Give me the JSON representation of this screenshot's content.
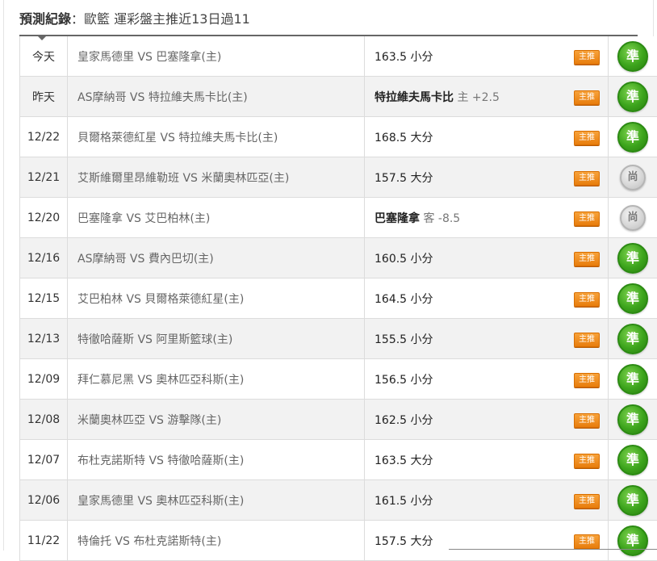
{
  "header": {
    "title": "預測紀錄",
    "separator": "：",
    "subtitle": "歐籃 運彩盤主推近13日過11"
  },
  "colors": {
    "badge": "#f08a1c",
    "result_hit": "#3ca41c",
    "result_miss": "#cfcfcf",
    "row_alt": "#f2f2f2"
  },
  "rows": [
    {
      "date": "今天",
      "match": "皇家馬德里 VS 巴塞隆拿(主)",
      "pick_main": "163.5 小分",
      "pick_extra": "",
      "badge": "主推",
      "result": "準",
      "hit": true
    },
    {
      "date": "昨天",
      "match": "AS摩納哥 VS 特拉維夫馬卡比(主)",
      "pick_main": "特拉維夫馬卡比",
      "pick_extra": " 主 +2.5",
      "badge": "主推",
      "result": "準",
      "hit": true
    },
    {
      "date": "12/22",
      "match": "貝爾格萊德紅星 VS 特拉維夫馬卡比(主)",
      "pick_main": "168.5 大分",
      "pick_extra": "",
      "badge": "主推",
      "result": "準",
      "hit": true
    },
    {
      "date": "12/21",
      "match": "艾斯維爾里昂維勒班 VS 米蘭奧林匹亞(主)",
      "pick_main": "157.5 大分",
      "pick_extra": "",
      "badge": "主推",
      "result": "尚",
      "hit": false
    },
    {
      "date": "12/20",
      "match": "巴塞隆拿 VS 艾巴柏林(主)",
      "pick_main": "巴塞隆拿",
      "pick_extra": " 客 -8.5",
      "badge": "主推",
      "result": "尚",
      "hit": false
    },
    {
      "date": "12/16",
      "match": "AS摩納哥 VS 費內巴切(主)",
      "pick_main": "160.5 小分",
      "pick_extra": "",
      "badge": "主推",
      "result": "準",
      "hit": true
    },
    {
      "date": "12/15",
      "match": "艾巴柏林 VS 貝爾格萊德紅星(主)",
      "pick_main": "164.5 小分",
      "pick_extra": "",
      "badge": "主推",
      "result": "準",
      "hit": true
    },
    {
      "date": "12/13",
      "match": "特徹哈薩斯 VS 阿里斯籃球(主)",
      "pick_main": "155.5 小分",
      "pick_extra": "",
      "badge": "主推",
      "result": "準",
      "hit": true
    },
    {
      "date": "12/09",
      "match": "拜仁慕尼黑 VS 奧林匹亞科斯(主)",
      "pick_main": "156.5 小分",
      "pick_extra": "",
      "badge": "主推",
      "result": "準",
      "hit": true
    },
    {
      "date": "12/08",
      "match": "米蘭奧林匹亞 VS 游擊隊(主)",
      "pick_main": "162.5 小分",
      "pick_extra": "",
      "badge": "主推",
      "result": "準",
      "hit": true
    },
    {
      "date": "12/07",
      "match": "布杜克諾斯特 VS 特徹哈薩斯(主)",
      "pick_main": "163.5 大分",
      "pick_extra": "",
      "badge": "主推",
      "result": "準",
      "hit": true
    },
    {
      "date": "12/06",
      "match": "皇家馬德里 VS 奧林匹亞科斯(主)",
      "pick_main": "161.5 小分",
      "pick_extra": "",
      "badge": "主推",
      "result": "準",
      "hit": true
    },
    {
      "date": "11/22",
      "match": "特倫托 VS 布杜克諾斯特(主)",
      "pick_main": "157.5 大分",
      "pick_extra": "",
      "badge": "主推",
      "result": "準",
      "hit": true
    }
  ]
}
